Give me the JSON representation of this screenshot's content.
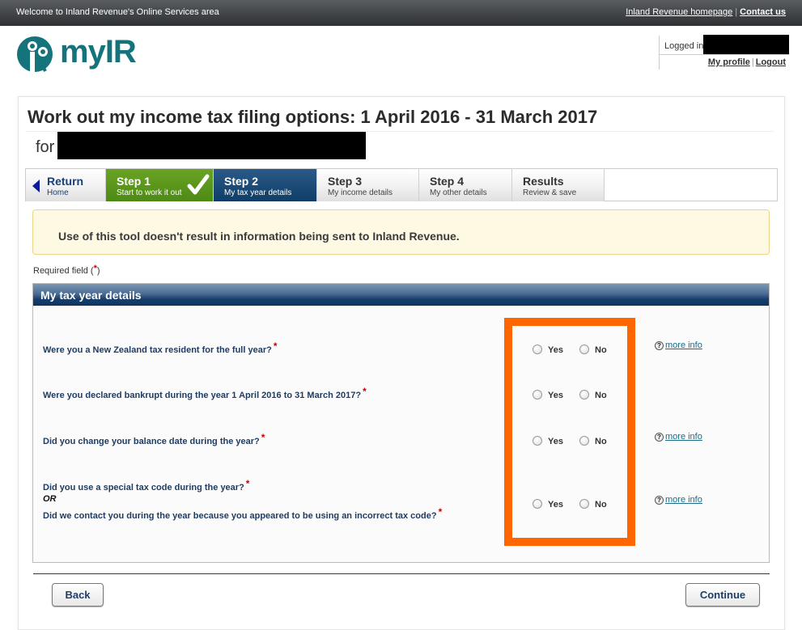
{
  "topbar": {
    "welcome": "Welcome to Inland Revenue's Online Services area",
    "homepage_link": "Inland Revenue homepage",
    "separator": "|",
    "contact_link": "Contact us"
  },
  "logo": {
    "wordmark": "myIR",
    "brand_color": "#14737b"
  },
  "user": {
    "logged_in_label": "Logged in as",
    "profile_link": "My profile",
    "separator": "|",
    "logout_link": "Logout"
  },
  "page": {
    "title": "Work out my income tax filing options: 1 April 2016 - 31 March 2017",
    "for_label": "for"
  },
  "steps": [
    {
      "title": "Return",
      "subtitle": "Home",
      "state": "back"
    },
    {
      "title": "Step 1",
      "subtitle": "Start to work it out",
      "state": "done"
    },
    {
      "title": "Step 2",
      "subtitle": "My tax year details",
      "state": "active"
    },
    {
      "title": "Step 3",
      "subtitle": "My income details",
      "state": "pending"
    },
    {
      "title": "Step 4",
      "subtitle": "My other details",
      "state": "pending"
    },
    {
      "title": "Results",
      "subtitle": "Review & save",
      "state": "pending"
    }
  ],
  "notice": "Use of this tool doesn't result in information being sent to Inland Revenue.",
  "required": {
    "label": "Required field (",
    "star": "*",
    "close": ")"
  },
  "section": {
    "title": "My tax year details",
    "questions": [
      {
        "text": "Were you a New Zealand tax resident for the full year?",
        "required": "*",
        "yes": "Yes",
        "no": "No",
        "more_info": "more info"
      },
      {
        "text": "Were you declared bankrupt during the year 1 April 2016 to 31 March 2017?",
        "required": "*",
        "yes": "Yes",
        "no": "No"
      },
      {
        "text": "Did you change your balance date during the year?",
        "required": "*",
        "yes": "Yes",
        "no": "No",
        "more_info": "more info"
      },
      {
        "text": "Did you use a special tax code during the year?",
        "required": "*",
        "or": "OR",
        "text2": "Did we contact you during the year because you appeared to be using an incorrect tax code?",
        "yes": "Yes",
        "no": "No",
        "more_info": "more info"
      }
    ]
  },
  "buttons": {
    "back": "Back",
    "continue": "Continue"
  },
  "colors": {
    "highlight": "#ff6600",
    "step_done": "#5a961c",
    "step_active": "#0f3d68",
    "required_star": "#cc0000"
  }
}
